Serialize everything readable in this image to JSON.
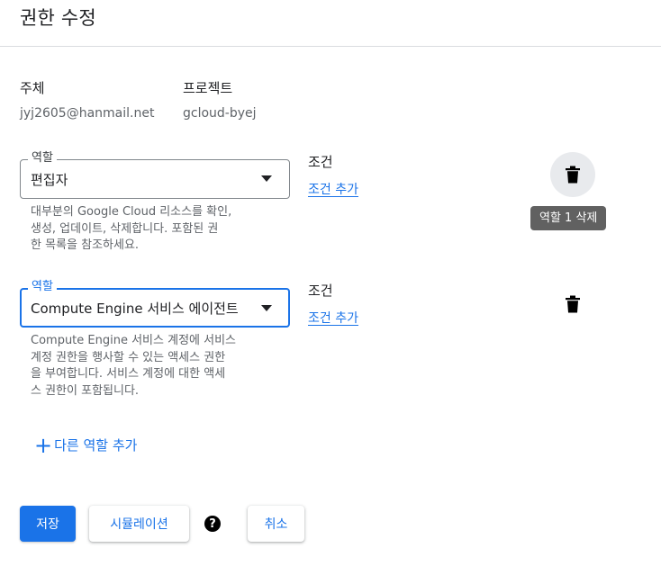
{
  "dialog": {
    "title": "권한 수정"
  },
  "principal": {
    "label": "주체",
    "value": "jyj2605@hanmail.net"
  },
  "project": {
    "label": "프로젝트",
    "value": "gcloud-byej"
  },
  "roles": [
    {
      "field_label": "역할",
      "value": "편집자",
      "hint_lines": [
        "대부분의 Google Cloud 리소스를 확인,",
        "생성, 업데이트, 삭제합니다. 포함된 권",
        "한 목록을 참조하세요."
      ],
      "condition_label": "조건",
      "add_condition": "조건 추가",
      "delete_tooltip": "역할 1 삭제",
      "delete_icon": "trash-icon"
    },
    {
      "field_label": "역할",
      "value": "Compute Engine 서비스 에이전트",
      "hint_lines": [
        "Compute Engine 서비스 계정에 서비스",
        "계정 권한을 행사할 수 있는 액세스 권한",
        "을 부여합니다. 서비스 계정에 대한 액세",
        "스 권한이 포함됩니다."
      ],
      "condition_label": "조건",
      "add_condition": "조건 추가",
      "delete_icon": "trash-icon"
    }
  ],
  "add_role": {
    "icon": "+",
    "label": "다른 역할 추가"
  },
  "actions": {
    "save": "저장",
    "simulate": "시뮬레이션",
    "help_icon": "?",
    "cancel": "취소"
  },
  "colors": {
    "accent": "#1a73e8",
    "tooltip_bg": "#616161",
    "delete_circle_bg": "#e8eaed"
  }
}
